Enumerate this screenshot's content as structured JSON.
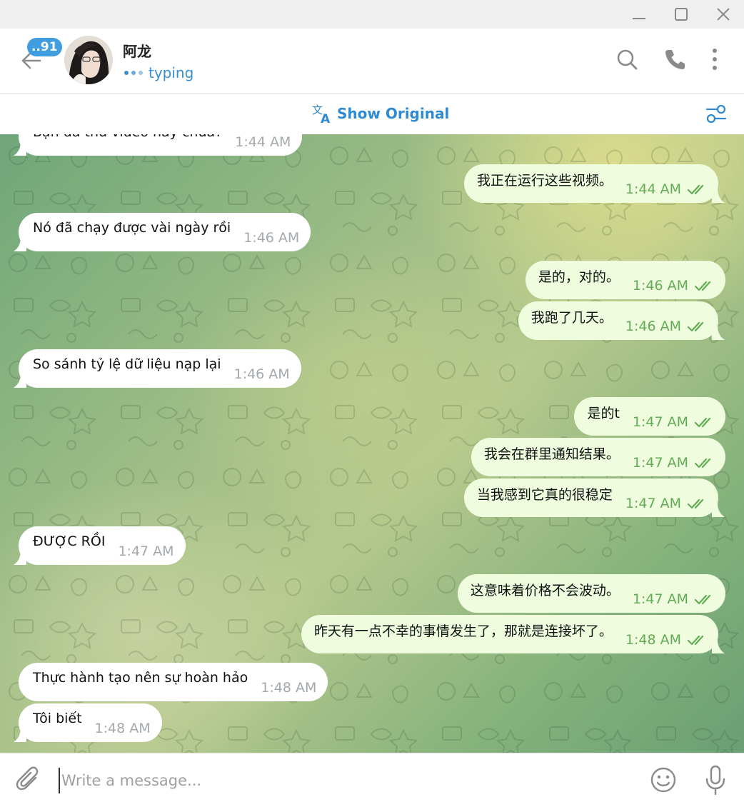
{
  "window": {
    "controls": [
      "minimize-icon",
      "maximize-icon",
      "close-icon"
    ]
  },
  "header": {
    "unread_badge": "..91",
    "contact_name": "阿龙",
    "status": "typing",
    "icons": [
      "back-arrow-icon",
      "search-icon",
      "phone-icon",
      "more-vertical-icon"
    ]
  },
  "translate_bar": {
    "label": "Show Original",
    "icons": [
      "translate-icon",
      "translate-settings-icon"
    ]
  },
  "messages": [
    {
      "dir": "in",
      "text": "Bạn đã thử video này chưa?",
      "time": "1:44 AM"
    },
    {
      "dir": "out",
      "text": "我正在运行这些视频。",
      "time": "1:44 AM",
      "read": true
    },
    {
      "dir": "in",
      "text": "Nó đã chạy được vài ngày rồi",
      "time": "1:46 AM"
    },
    {
      "dir": "out",
      "text": "是的，对的。",
      "time": "1:46 AM",
      "read": true
    },
    {
      "dir": "out",
      "text": "我跑了几天。",
      "time": "1:46 AM",
      "read": true
    },
    {
      "dir": "in",
      "text": "So sánh tỷ lệ dữ liệu nạp lại",
      "time": "1:46 AM"
    },
    {
      "dir": "out",
      "text": "是的t",
      "time": "1:47 AM",
      "read": true
    },
    {
      "dir": "out",
      "text": "我会在群里通知结果。",
      "time": "1:47 AM",
      "read": true
    },
    {
      "dir": "out",
      "text": "当我感到它真的很稳定",
      "time": "1:47 AM",
      "read": true
    },
    {
      "dir": "in",
      "text": "ĐƯỢC RỒI",
      "time": "1:47 AM"
    },
    {
      "dir": "out",
      "text": "这意味着价格不会波动。",
      "time": "1:47 AM",
      "read": true
    },
    {
      "dir": "out",
      "text": "昨天有一点不幸的事情发生了，那就是连接坏了。",
      "time": "1:48 AM",
      "read": true
    },
    {
      "dir": "in",
      "text": "Thực hành tạo nên sự hoàn hảo",
      "time": "1:48 AM"
    },
    {
      "dir": "in",
      "text": "Tôi biết",
      "time": "1:48 AM"
    }
  ],
  "composer": {
    "placeholder": "Write a message...",
    "value": "",
    "icons": [
      "attach-icon",
      "emoji-icon",
      "microphone-icon"
    ]
  },
  "colors": {
    "accent": "#3a8fd0",
    "outgoing_bubble": "#effdde",
    "incoming_bubble": "#ffffff",
    "outgoing_meta": "#62ac55",
    "badge": "#3f9de0"
  }
}
